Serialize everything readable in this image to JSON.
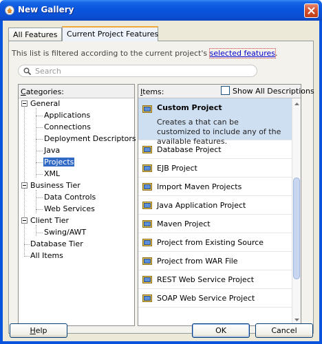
{
  "window": {
    "title": "New Gallery"
  },
  "tabs": [
    {
      "label": "All Features",
      "active": false
    },
    {
      "label": "Current Project Features",
      "active": true
    }
  ],
  "info": {
    "text": "This list is filtered according to the current project's ",
    "link": "selected features",
    "suffix": "."
  },
  "search": {
    "placeholder": "Search",
    "value": ""
  },
  "categories": {
    "label": "Categories:",
    "label_underline": "C",
    "label_rest": "ategories:",
    "tree": [
      {
        "label": "General",
        "level": 0,
        "expandable": true
      },
      {
        "label": "Applications",
        "level": 1
      },
      {
        "label": "Connections",
        "level": 1
      },
      {
        "label": "Deployment Descriptors",
        "level": 1
      },
      {
        "label": "Java",
        "level": 1
      },
      {
        "label": "Projects",
        "level": 1,
        "selected": true
      },
      {
        "label": "XML",
        "level": 1
      },
      {
        "label": "Business Tier",
        "level": 0,
        "expandable": true
      },
      {
        "label": "Data Controls",
        "level": 1
      },
      {
        "label": "Web Services",
        "level": 1
      },
      {
        "label": "Client Tier",
        "level": 0,
        "expandable": true
      },
      {
        "label": "Swing/AWT",
        "level": 1
      },
      {
        "label": "Database Tier",
        "level": 0
      },
      {
        "label": "All Items",
        "level": 0
      }
    ]
  },
  "items": {
    "label": "Items:",
    "label_underline": "I",
    "label_rest": "tems:",
    "show_all_label": "Show All Descriptions",
    "show_all_checked": false,
    "list": [
      {
        "title": "Custom Project",
        "selected": true,
        "description": "Creates a that can be customized to include any of the available features."
      },
      {
        "title": "Database Project"
      },
      {
        "title": "EJB Project"
      },
      {
        "title": "Import Maven Projects"
      },
      {
        "title": "Java Application Project"
      },
      {
        "title": "Maven Project"
      },
      {
        "title": "Project from Existing Source"
      },
      {
        "title": "Project from WAR File"
      },
      {
        "title": "REST Web Service Project"
      },
      {
        "title": "SOAP Web Service Project"
      }
    ]
  },
  "buttons": {
    "help": "Help",
    "help_underline": "H",
    "help_rest": "elp",
    "ok": "OK",
    "cancel": "Cancel"
  },
  "colors": {
    "titlebar": "#0a55dc",
    "selection": "#316ac5",
    "item_selected_bg": "#cfdff2",
    "link": "#0000cc"
  },
  "icons": {
    "title": "gallery-icon",
    "close": "close-icon",
    "search": "search-icon",
    "item": "project-folder-icon"
  }
}
